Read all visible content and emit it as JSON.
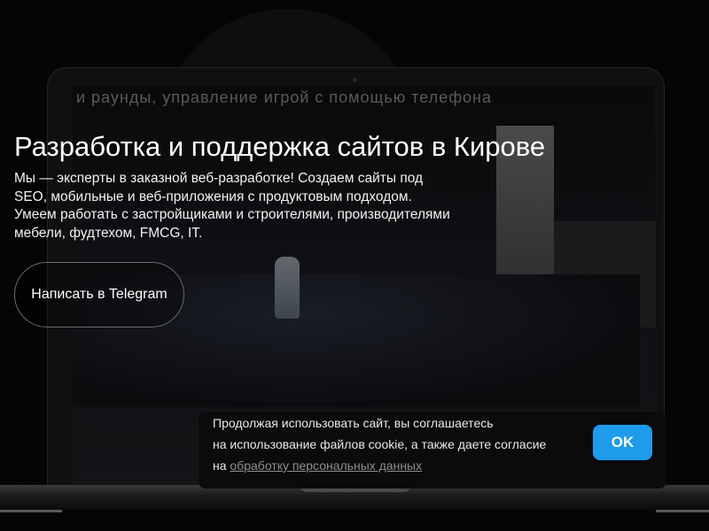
{
  "background": {
    "screen_caption": "и раунды, управление игрой с помощью телефона"
  },
  "hero": {
    "title": "Разработка и поддержка сайтов в Кирове",
    "description": "Мы — эксперты в заказной веб-разработке! Создаем сайты под SEO, мобильные и веб-приложения с продуктовым подходом. Умеем работать с застройщиками и строителями, производителями мебели, фудтехом, FMCG, IT.",
    "cta_label": "Написать в Telegram"
  },
  "cookie": {
    "line1": "Продолжая использовать сайт, вы соглашаетесь",
    "line2": "на использование файлов cookie, а также даете согласие",
    "line3_prefix": "на ",
    "link_text": "обработку персональных данных",
    "ok_label": "OK"
  },
  "colors": {
    "accent": "#1e9bea",
    "background": "#050505"
  }
}
